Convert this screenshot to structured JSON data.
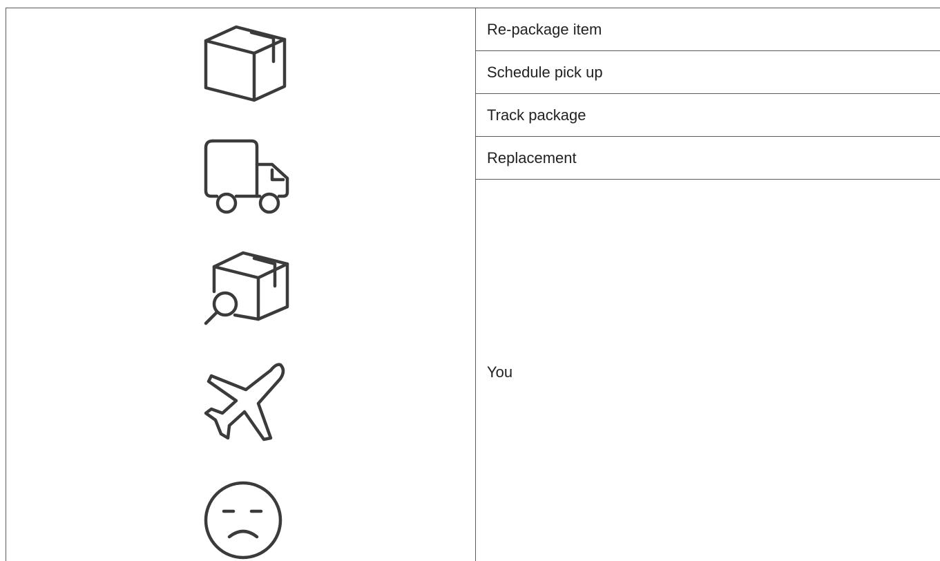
{
  "icons": [
    {
      "name": "box-icon"
    },
    {
      "name": "delivery-truck-icon"
    },
    {
      "name": "package-search-icon"
    },
    {
      "name": "airplane-icon"
    },
    {
      "name": "sad-face-icon"
    }
  ],
  "options": [
    {
      "label": "Re-package item"
    },
    {
      "label": "Schedule pick up"
    },
    {
      "label": "Track package"
    },
    {
      "label": "Replacement"
    }
  ],
  "response": {
    "text": "You"
  },
  "colors": {
    "border": "#5a5a5a",
    "icon": "#3b3b3b",
    "text": "#222222"
  }
}
